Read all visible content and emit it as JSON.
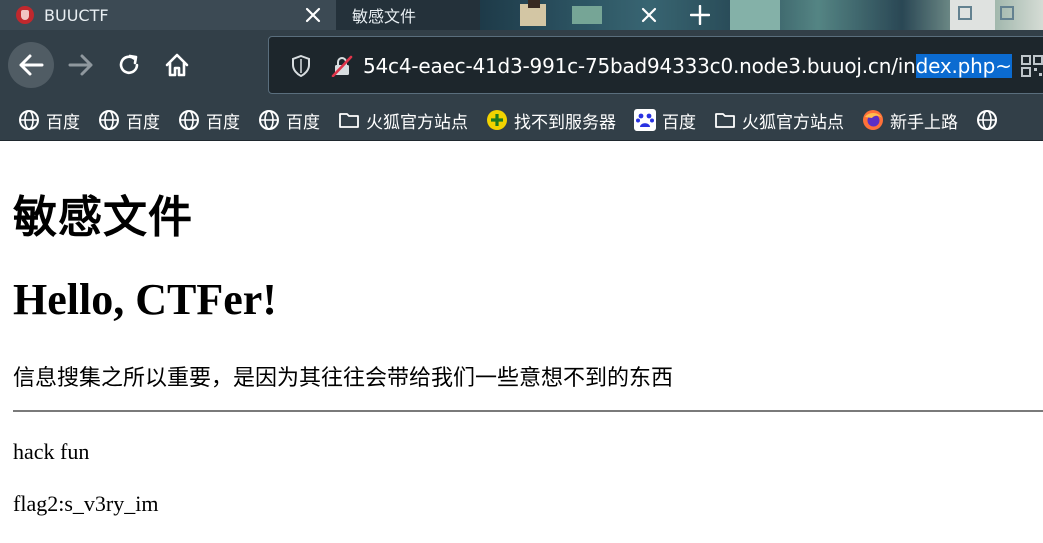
{
  "browser": {
    "tabs": [
      {
        "label": "BUUCTF",
        "active": true
      },
      {
        "label": "敏感文件",
        "active": false
      }
    ],
    "url": {
      "prefix": "54c4-eaec-41d3-991c-75bad94333c0.node3.buuoj.cn/in",
      "selected": "dex.php~"
    },
    "bookmarks": [
      {
        "label": "百度",
        "icon": "globe-icon"
      },
      {
        "label": "百度",
        "icon": "globe-icon"
      },
      {
        "label": "百度",
        "icon": "globe-icon"
      },
      {
        "label": "百度",
        "icon": "globe-icon"
      },
      {
        "label": "火狐官方站点",
        "icon": "folder-icon"
      },
      {
        "label": "找不到服务器",
        "icon": "plus-circle-icon"
      },
      {
        "label": "百度",
        "icon": "baidu-paw-icon"
      },
      {
        "label": "火狐官方站点",
        "icon": "folder-icon"
      },
      {
        "label": "新手上路",
        "icon": "firefox-icon"
      }
    ],
    "colors": {
      "chrome": "#323f48",
      "tabstrip": "#24313a",
      "selection": "#0b6bd1"
    }
  },
  "page": {
    "heading1": "敏感文件",
    "heading2": "Hello, CTFer!",
    "info": "信息搜集之所以重要，是因为其往往会带给我们一些意想不到的东西",
    "hack": "hack fun",
    "flag": "flag2:s_v3ry_im"
  }
}
